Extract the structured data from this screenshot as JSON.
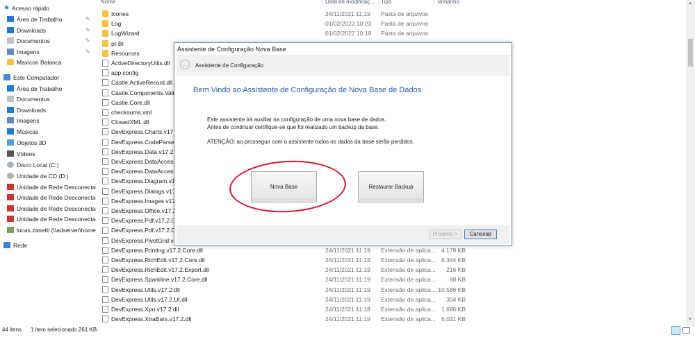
{
  "nav": {
    "quick_access": "Acesso rápido",
    "items": [
      {
        "label": "Área de Trabalho",
        "icon": "desktop-icon",
        "pinned": true
      },
      {
        "label": "Downloads",
        "icon": "download-icon",
        "pinned": true
      },
      {
        "label": "Documentos",
        "icon": "document-icon",
        "pinned": true
      },
      {
        "label": "Imagens",
        "icon": "pictures-icon",
        "pinned": true
      },
      {
        "label": "Maxicon Balanca",
        "icon": "folder-icon",
        "pinned": false
      },
      {
        "label": "Este Computador",
        "icon": "computer-icon",
        "pinned": false
      },
      {
        "label": "Área de Trabalho",
        "icon": "desktop-icon",
        "pinned": false
      },
      {
        "label": "Documentos",
        "icon": "document-icon",
        "pinned": false
      },
      {
        "label": "Downloads",
        "icon": "download-icon",
        "pinned": false
      },
      {
        "label": "Imagens",
        "icon": "pictures-icon",
        "pinned": false
      },
      {
        "label": "Músicas",
        "icon": "music-icon",
        "pinned": false
      },
      {
        "label": "Objetos 3D",
        "icon": "cube-icon",
        "pinned": false
      },
      {
        "label": "Vídeos",
        "icon": "video-icon",
        "pinned": false
      },
      {
        "label": "Disco Local (C:)",
        "icon": "drive-icon",
        "pinned": false
      },
      {
        "label": "Unidade de CD (D:)",
        "icon": "cd-icon",
        "pinned": false
      },
      {
        "label": "Unidade de Rede Desconectada",
        "icon": "network-drive-disconnected-icon",
        "pinned": false
      },
      {
        "label": "Unidade de Rede Desconectada",
        "icon": "network-drive-disconnected-icon",
        "pinned": false
      },
      {
        "label": "Unidade de Rede Desconectada",
        "icon": "network-drive-disconnected-icon",
        "pinned": false
      },
      {
        "label": "Unidade de Rede Desconectada",
        "icon": "network-drive-disconnected-icon",
        "pinned": false
      },
      {
        "label": "lucas.zanetti (\\\\adserver\\home)",
        "icon": "network-drive-icon",
        "pinned": false
      },
      {
        "label": "Rede",
        "icon": "network-icon",
        "pinned": false
      }
    ]
  },
  "columns": {
    "name": "Nome",
    "date": "Data de modificaç...",
    "type": "Tipo",
    "size": "Tamanho"
  },
  "files": [
    {
      "name": "Icones",
      "date": "24/11/2021 11:19",
      "type": "Pasta de arquivos",
      "size": "",
      "kind": "folder"
    },
    {
      "name": "Log",
      "date": "01/02/2022 10:23",
      "type": "Pasta de arquivos",
      "size": "",
      "kind": "folder"
    },
    {
      "name": "LogWizard",
      "date": "01/02/2022 10:19",
      "type": "Pasta de arquivos",
      "size": "",
      "kind": "folder"
    },
    {
      "name": "pt-Br",
      "date": "",
      "type": "",
      "size": "",
      "kind": "folder"
    },
    {
      "name": "Resources",
      "date": "",
      "type": "",
      "size": "",
      "kind": "folder"
    },
    {
      "name": "ActiveDirectoryUtils.dll",
      "date": "",
      "type": "",
      "size": "",
      "kind": "file"
    },
    {
      "name": "app.config",
      "date": "",
      "type": "",
      "size": "",
      "kind": "file"
    },
    {
      "name": "Castle.ActiveRecord.dll",
      "date": "",
      "type": "",
      "size": "",
      "kind": "file"
    },
    {
      "name": "Castle.Components.Valida",
      "date": "",
      "type": "",
      "size": "",
      "kind": "file"
    },
    {
      "name": "Castle.Core.dll",
      "date": "",
      "type": "",
      "size": "",
      "kind": "file"
    },
    {
      "name": "checksums.xml",
      "date": "",
      "type": "",
      "size": "",
      "kind": "file"
    },
    {
      "name": "ClosedXML.dll",
      "date": "",
      "type": "",
      "size": "",
      "kind": "file"
    },
    {
      "name": "DevExpress.Charts.v17.2.C",
      "date": "",
      "type": "",
      "size": "",
      "kind": "file"
    },
    {
      "name": "DevExpress.CodeParser.v1",
      "date": "",
      "type": "",
      "size": "",
      "kind": "file"
    },
    {
      "name": "DevExpress.Data.v17.2.dll",
      "date": "",
      "type": "",
      "size": "",
      "kind": "file"
    },
    {
      "name": "DevExpress.DataAccess.v1",
      "date": "",
      "type": "",
      "size": "",
      "kind": "file"
    },
    {
      "name": "DevExpress.DataAccess.v1",
      "date": "",
      "type": "",
      "size": "",
      "kind": "file"
    },
    {
      "name": "DevExpress.Diagram.v17.2",
      "date": "",
      "type": "",
      "size": "",
      "kind": "file"
    },
    {
      "name": "DevExpress.Dialogs.v17.2.",
      "date": "",
      "type": "",
      "size": "",
      "kind": "file"
    },
    {
      "name": "DevExpress.Images.v17.2.d",
      "date": "",
      "type": "",
      "size": "",
      "kind": "file"
    },
    {
      "name": "DevExpress.Office.v17.2.Co",
      "date": "",
      "type": "",
      "size": "",
      "kind": "file"
    },
    {
      "name": "DevExpress.Pdf.v17.2.Core",
      "date": "",
      "type": "",
      "size": "",
      "kind": "file"
    },
    {
      "name": "DevExpress.Pdf.v17.2.Draw",
      "date": "",
      "type": "",
      "size": "",
      "kind": "file"
    },
    {
      "name": "DevExpress.PivotGrid.v17.",
      "date": "",
      "type": "",
      "size": "",
      "kind": "file"
    },
    {
      "name": "DevExpress.Printing.v17.2.Core.dll",
      "date": "24/11/2021 11:19",
      "type": "Extensão de aplica...",
      "size": "4.179 KB",
      "kind": "file"
    },
    {
      "name": "DevExpress.RichEdit.v17.2.Core.dll",
      "date": "24/11/2021 11:19",
      "type": "Extensão de aplica...",
      "size": "6.344 KB",
      "kind": "file"
    },
    {
      "name": "DevExpress.RichEdit.v17.2.Export.dll",
      "date": "24/11/2021 11:19",
      "type": "Extensão de aplica...",
      "size": "216 KB",
      "kind": "file"
    },
    {
      "name": "DevExpress.Sparkline.v17.2.Core.dll",
      "date": "24/11/2021 11:19",
      "type": "Extensão de aplica...",
      "size": "88 KB",
      "kind": "file"
    },
    {
      "name": "DevExpress.Utils.v17.2.dll",
      "date": "24/11/2021 11:19",
      "type": "Extensão de aplica...",
      "size": "10.586 KB",
      "kind": "file"
    },
    {
      "name": "DevExpress.Utils.v17.2.UI.dll",
      "date": "24/11/2021 11:19",
      "type": "Extensão de aplica...",
      "size": "304 KB",
      "kind": "file"
    },
    {
      "name": "DevExpress.Xpo.v17.2.dll",
      "date": "24/11/2021 11:18",
      "type": "Extensão de aplica...",
      "size": "1.686 KB",
      "kind": "file"
    },
    {
      "name": "DevExpress.XtraBars.v17.2.dll",
      "date": "24/11/2021 11:19",
      "type": "Extensão de aplica...",
      "size": "6.031 KB",
      "kind": "file"
    }
  ],
  "status": {
    "count": "44 itens",
    "selection": "1 item selecionado  261 KB"
  },
  "dialog": {
    "title": "Assistente de Configuração Nova Base",
    "nav_label": "Assistente de Configuração",
    "heading": "Bem Vindo ao Assistente de Configuração de Nova Base de Dados",
    "line1": "Este assistente irá auxiliar na configuração de uma nova base de dados.",
    "line2": "Antes de continuar certifique-se que foi realizado um backup da base.",
    "warning": "ATENÇÃO: ao prosseguir com o assistente todos os dados da base serão perdidos.",
    "btn_new": "Nova Base",
    "btn_restore": "Restaurar Backup",
    "btn_next": "Próximo >",
    "btn_cancel": "Cancelar"
  },
  "colors": {
    "accent": "#1f5fa8",
    "annotation": "#e0142a",
    "folder": "#f6c343"
  }
}
